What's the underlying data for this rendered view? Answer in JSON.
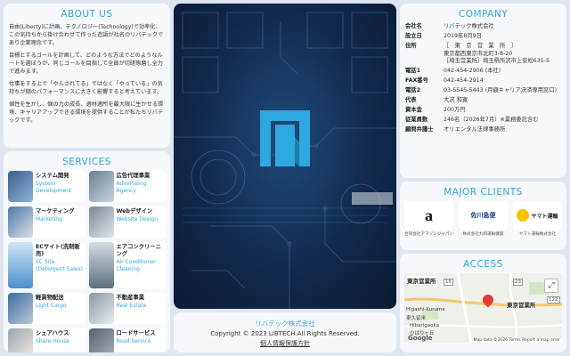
{
  "about": {
    "title": "ABOUT US",
    "paragraphs": [
      "自由(Liberty)に計画、テクノロジー(Technology)で効率化、この気持ちから掛け合わせて作った造語が社名のリバテックであり企業理念です。",
      "目標とするゴールを計画して、どのような方法でどのようなルートを選ぼうが、同じゴールを目指して全員が切磋琢磨し全力で進みます。",
      "仕事をする上で「やらされてる」ではなく「やっている」の気持ちが個のパフォーマンスに大きく影響すると考えています。",
      "個性を生かし、個の力の成長、適材適所を最大限に生かせる環境、キャリアアップできる環境を提供することが私たちリバテックです。"
    ]
  },
  "services": {
    "title": "SERVICES",
    "items": [
      {
        "jp": "システム開発",
        "en": "System Development",
        "color": "#3b5f8a"
      },
      {
        "jp": "広告代理事業",
        "en": "Advertising Agency",
        "color": "#6a7f95"
      },
      {
        "jp": "マーケティング",
        "en": "Marketing",
        "color": "#4d7aa8"
      },
      {
        "jp": "Webデザイン",
        "en": "Website Design",
        "color": "#7b8796"
      },
      {
        "jp": "ECサイト(洗剤販売)",
        "en": "EC Site (Detergent Sales)",
        "color": "#4c8fc9"
      },
      {
        "jp": "エアコンクリーニング",
        "en": "Air Conditioner Cleaning",
        "color": "#5e6f7e"
      },
      {
        "jp": "軽貨物配送",
        "en": "Light Cargo",
        "color": "#3f6c9a"
      },
      {
        "jp": "不動産事業",
        "en": "Real Estate",
        "color": "#8a96a3"
      },
      {
        "jp": "シェアハウス",
        "en": "Share House",
        "color": "#9aa8b5"
      },
      {
        "jp": "ロードサービス",
        "en": "Road Service",
        "color": "#56616d"
      }
    ]
  },
  "footer": {
    "company_name": "リバテック株式会社",
    "copyright": "Copyright © 2023 LIBTECH All Rights Reserved.",
    "privacy_link": "個人情報保護方針"
  },
  "company": {
    "title": "COMPANY",
    "rows": [
      {
        "k": "会社名",
        "v": "リバテック株式会社"
      },
      {
        "k": "設立日",
        "v": "2019年8月9日"
      },
      {
        "k": "住所",
        "v": "［　東　京　営　業　所　］\n東京都西東京市北町3-8-20\n［埼玉営業所］埼玉県所沢市上安松635-5"
      },
      {
        "k": "電話1",
        "v": "042-454-2906 (本社)"
      },
      {
        "k": "FAX番号",
        "v": "042-454-2914"
      },
      {
        "k": "電話2",
        "v": "03-5545-5443 (月額キャリア決済専用窓口)"
      },
      {
        "k": "代表",
        "v": "大沢 和寛"
      },
      {
        "k": "資本金",
        "v": "200万円"
      },
      {
        "k": "従業員数",
        "v": "246名（2026年7月）※業務委託含む"
      },
      {
        "k": "顧問弁護士",
        "v": "オリエンタル法律事務所"
      }
    ]
  },
  "clients": {
    "title": "MAJOR CLIENTS",
    "items": [
      {
        "logo": "a",
        "caption": "合同会社アマゾンジャパン"
      },
      {
        "logo": "佐川急便",
        "caption": "株式会社丸和運輸機関"
      },
      {
        "logo": "ヤマト運輸",
        "caption": "ヤマト運輸株式会社"
      }
    ]
  },
  "access": {
    "title": "ACCESS",
    "map_title": "東京営業所",
    "marker_label": "東京営業所",
    "place_1": "Higashi-Kurume",
    "place_2": "東久留米",
    "place_3": "Hibarigaoka",
    "place_4": "ひばりヶ丘",
    "logo_text": "Google",
    "attribution": "Map data ©2026   Terms   Report a map error",
    "route_1": "15",
    "route_2": "23",
    "route_3": "122"
  },
  "colors": {
    "accent": "#2ea8df",
    "hero_logo": "#2ea8df",
    "hero_bg": "#112a4d"
  }
}
